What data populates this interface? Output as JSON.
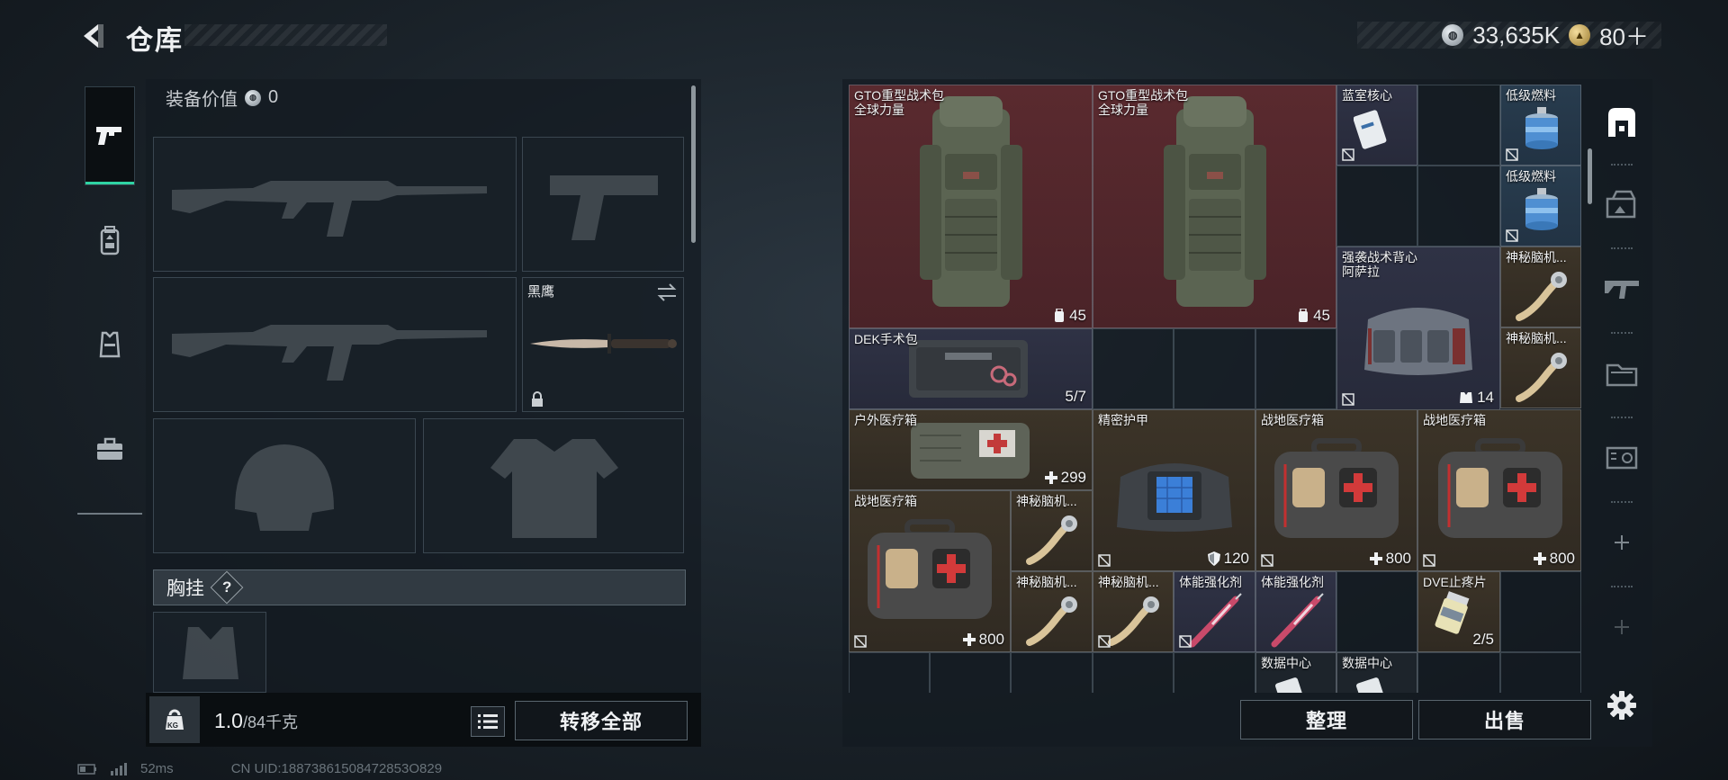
{
  "header": {
    "title": "仓库",
    "currency": [
      {
        "value": "33,635K",
        "icon": "silver-coin-icon"
      },
      {
        "value": "80＋",
        "icon": "gold-coin-icon"
      }
    ]
  },
  "left_nav": [
    {
      "icon": "pistol-icon",
      "active": true
    },
    {
      "icon": "backpack-icon",
      "active": false
    },
    {
      "icon": "vest-icon",
      "active": false
    },
    {
      "icon": "toolbox-icon",
      "active": false
    }
  ],
  "equipment": {
    "value_label": "装备价值",
    "value": "0",
    "knife_name": "黑鹰",
    "chest_rig_label": "胸挂",
    "help": "?",
    "weight_current": "1.0",
    "weight_max": "/84千克",
    "weight_icon_text": "KG",
    "transfer_all": "转移全部"
  },
  "status": {
    "ping": "52ms",
    "uid": "CN UID:18873861508472853O829"
  },
  "storage": {
    "items": [
      {
        "name": "GTO重型战术包\n全球力量",
        "stat": "45",
        "stat_icon": "backpack-capacity-icon"
      },
      {
        "name": "GTO重型战术包\n全球力量",
        "stat": "45",
        "stat_icon": "backpack-capacity-icon"
      },
      {
        "name": "蓝室核心"
      },
      {
        "name": "低级燃料"
      },
      {
        "name": "低级燃料"
      },
      {
        "name": "强袭战术背心\n阿萨拉",
        "stat": "14",
        "stat_icon": "vest-capacity-icon"
      },
      {
        "name": "神秘脑机..."
      },
      {
        "name": "神秘脑机..."
      },
      {
        "name": "DEK手术包",
        "stat": "5/7"
      },
      {
        "name": "户外医疗箱",
        "stat": "299",
        "stat_icon": "heal-cross-icon"
      },
      {
        "name": "精密护甲",
        "stat": "120",
        "stat_icon": "armor-shield-icon"
      },
      {
        "name": "战地医疗箱",
        "stat": "800",
        "stat_icon": "heal-cross-icon"
      },
      {
        "name": "战地医疗箱",
        "stat": "800",
        "stat_icon": "heal-cross-icon"
      },
      {
        "name": "战地医疗箱",
        "stat": "800",
        "stat_icon": "heal-cross-icon"
      },
      {
        "name": "神秘脑机..."
      },
      {
        "name": "神秘脑机..."
      },
      {
        "name": "神秘脑机..."
      },
      {
        "name": "体能强化剂"
      },
      {
        "name": "体能强化剂"
      },
      {
        "name": "DVE止疼片",
        "stat": "2/5"
      },
      {
        "name": "数据中心"
      },
      {
        "name": "数据中心"
      }
    ],
    "sort_label": "整理",
    "sell_label": "出售"
  },
  "right_nav": [
    "storage-icon",
    "crate-icon",
    "rifle-icon",
    "folder-icon",
    "tag-icon",
    "add-icon",
    "add-icon"
  ],
  "colors": {
    "accent": "#2fd3a3",
    "red_rarity": "#5a2a2f",
    "purple_rarity": "#2f3245",
    "blue_rarity": "#283c4e",
    "gold_rarity": "#3c3428"
  }
}
